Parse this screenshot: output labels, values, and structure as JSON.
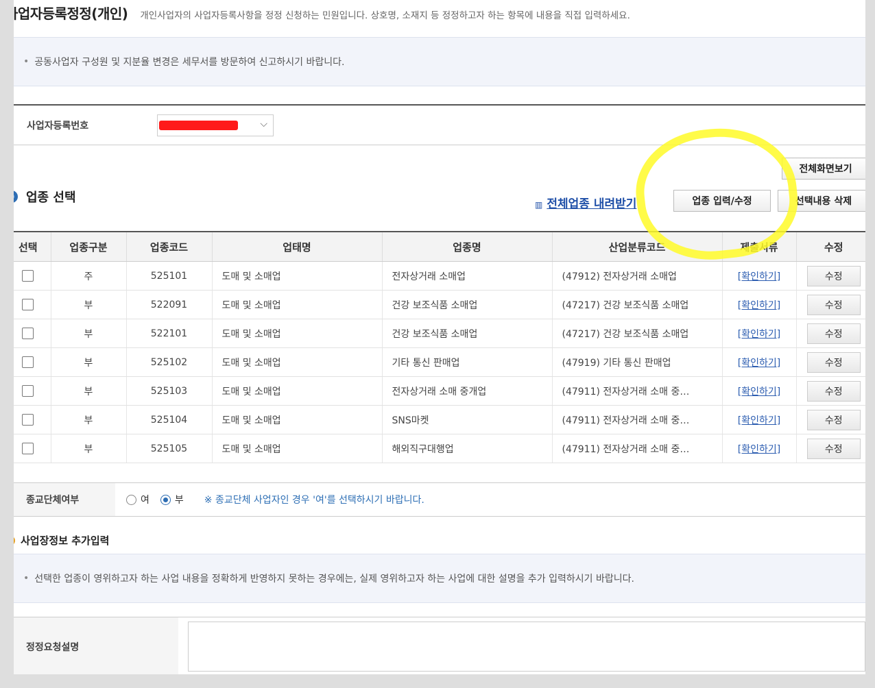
{
  "header": {
    "title": "사업자등록정정(개인)",
    "subtitle": "개인사업자의 사업자등록사항을 정정 신청하는 민원입니다. 상호명, 소재지 등 정정하고자 하는 항목에 내용을 직접 입력하세요."
  },
  "notice_top": "공동사업자 구성원 및 지분율 변경은 세무서를 방문하여 신고하시기 바랍니다.",
  "registration": {
    "label": "사업자등록번호"
  },
  "buttons": {
    "fullscreen": "전체화면보기",
    "download_all": "전체업종 내려받기",
    "edit_industry": "업종 입력/수정",
    "delete_selected": "선택내용 삭제"
  },
  "industry_section": {
    "title": "업종 선택",
    "columns": [
      "선택",
      "업종구분",
      "업종코드",
      "업태명",
      "업종명",
      "산업분류코드",
      "제출서류",
      "수정"
    ],
    "rows": [
      {
        "type": "주",
        "code": "525101",
        "business": "도매 및 소매업",
        "industry": "전자상거래 소매업",
        "class_code": "(47912) 전자상거래 소매업",
        "doc": "[확인하기]",
        "edit": "수정"
      },
      {
        "type": "부",
        "code": "522091",
        "business": "도매 및 소매업",
        "industry": "건강 보조식품 소매업",
        "class_code": "(47217) 건강 보조식품 소매업",
        "doc": "[확인하기]",
        "edit": "수정"
      },
      {
        "type": "부",
        "code": "522101",
        "business": "도매 및 소매업",
        "industry": "건강 보조식품 소매업",
        "class_code": "(47217) 건강 보조식품 소매업",
        "doc": "[확인하기]",
        "edit": "수정"
      },
      {
        "type": "부",
        "code": "525102",
        "business": "도매 및 소매업",
        "industry": "기타 통신 판매업",
        "class_code": "(47919) 기타 통신 판매업",
        "doc": "[확인하기]",
        "edit": "수정"
      },
      {
        "type": "부",
        "code": "525103",
        "business": "도매 및 소매업",
        "industry": "전자상거래 소매 중개업",
        "class_code": "(47911) 전자상거래 소매 중…",
        "doc": "[확인하기]",
        "edit": "수정"
      },
      {
        "type": "부",
        "code": "525104",
        "business": "도매 및 소매업",
        "industry": "SNS마켓",
        "class_code": "(47911) 전자상거래 소매 중…",
        "doc": "[확인하기]",
        "edit": "수정"
      },
      {
        "type": "부",
        "code": "525105",
        "business": "도매 및 소매업",
        "industry": "해외직구대행업",
        "class_code": "(47911) 전자상거래 소매 중…",
        "doc": "[확인하기]",
        "edit": "수정"
      }
    ]
  },
  "religion": {
    "label": "종교단체여부",
    "option_yes": "여",
    "option_no": "부",
    "selected": "부",
    "note": "※ 종교단체 사업자인 경우 '여'를 선택하시기 바랍니다."
  },
  "workplace_section": {
    "title": "사업장정보 추가입력",
    "notice": "선택한 업종이 영위하고자 하는 사업 내용을 정확하게 반영하지 못하는 경우에는, 실제 영위하고자 하는 사업에 대한 설명을 추가 입력하시기 바랍니다."
  },
  "request": {
    "label": "정정요청설명"
  },
  "colors": {
    "accent_blue": "#2d6db3",
    "link_blue": "#1f4fa8",
    "highlight_yellow": "#fffa28",
    "redaction_red": "#ff1a1a"
  }
}
